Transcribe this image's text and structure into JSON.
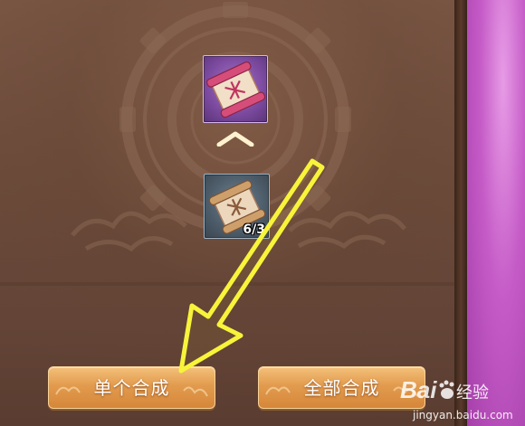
{
  "colors": {
    "panel_bg": "#6b4a3a",
    "side_panel": "#c55bc7",
    "button": "#e29b4e",
    "arrow": "#f7f43a",
    "slot_top": "#7b4a9f",
    "slot_bottom": "#4d5c69"
  },
  "synthesis": {
    "target_item": {
      "icon": "red-scroll-icon",
      "count": ""
    },
    "material_item": {
      "icon": "scroll-icon",
      "count": "6/3"
    },
    "direction_icon": "chevron-up-icon"
  },
  "buttons": {
    "single_label": "单个合成",
    "all_label": "全部合成"
  },
  "watermark": {
    "logo": "Bai",
    "text": "经验",
    "url": "jingyan.baidu.com"
  }
}
